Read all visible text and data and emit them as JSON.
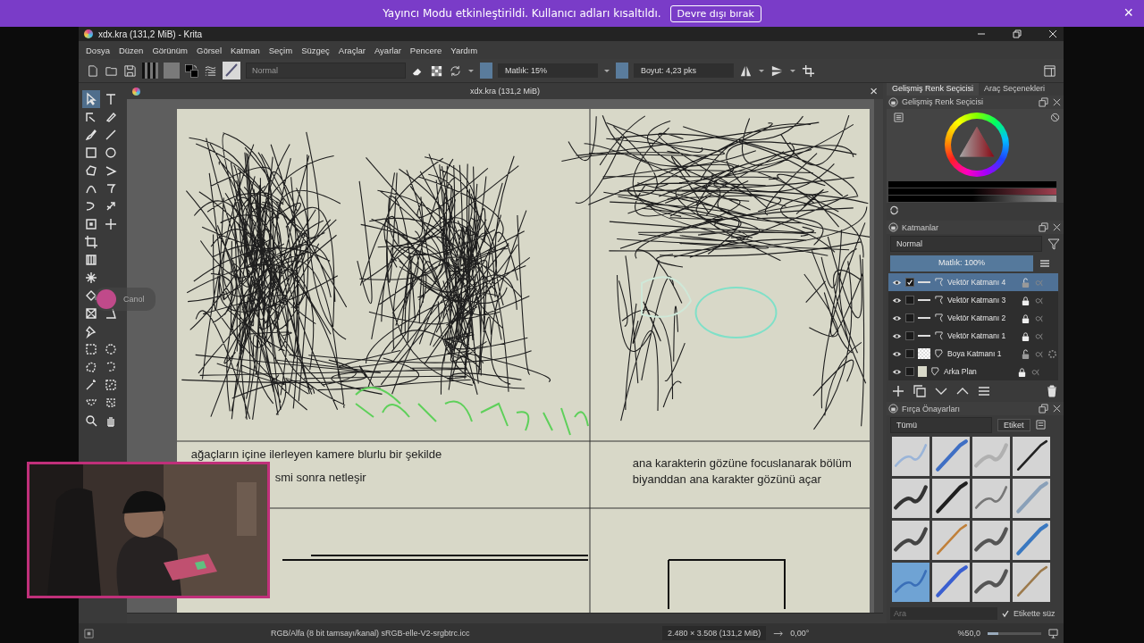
{
  "banner": {
    "message": "Yayıncı Modu etkinleştirildi. Kullanıcı adları kısaltıldı.",
    "button": "Devre dışı bırak",
    "close": "×"
  },
  "window": {
    "title": "xdx.kra (131,2 MiB)  - Krita"
  },
  "menu": [
    "Dosya",
    "Düzen",
    "Görünüm",
    "Görsel",
    "Katman",
    "Seçim",
    "Süzgeç",
    "Araçlar",
    "Ayarlar",
    "Pencere",
    "Yardım"
  ],
  "toolbar": {
    "blend_mode": "Normal",
    "opacity": "Matlık: 15%",
    "size": "Boyut: 4,23 pks"
  },
  "document_tab": {
    "title": "xdx.kra (131,2 MiB)",
    "close": "×"
  },
  "tools": [
    {
      "selected": true
    },
    {
      "selected": false
    },
    {
      "selected": false
    },
    {
      "selected": false
    },
    {
      "selected": false
    },
    {
      "selected": false
    },
    {
      "selected": false
    },
    {
      "selected": false
    },
    {
      "selected": false
    },
    {
      "selected": false
    },
    {
      "selected": false
    },
    {
      "selected": false
    },
    {
      "selected": false
    },
    {
      "selected": false
    },
    {
      "selected": false
    },
    {
      "selected": false
    },
    {
      "selected": false
    },
    {
      "selected": false
    },
    {
      "selected": false
    },
    {
      "selected": false
    },
    {
      "selected": false
    },
    {
      "selected": false
    },
    {
      "selected": false
    },
    {
      "selected": false
    },
    {
      "selected": false
    },
    {
      "selected": false
    },
    {
      "selected": false
    },
    {
      "selected": false
    },
    {
      "selected": false
    },
    {
      "selected": false
    },
    {
      "selected": false
    },
    {
      "selected": false
    },
    {
      "selected": false
    }
  ],
  "canvas": {
    "captions": [
      "ağaçların içine ilerleyen kamere blurlu bir şekilde",
      "smi sonra netleşir",
      "ana karakterin gözüne focuslanarak bölüm",
      "biyanddan ana karakter gözünü açar"
    ]
  },
  "stream_overlay": {
    "chat_name": "Canol"
  },
  "dock": {
    "tabs": [
      {
        "label": "Gelişmiş Renk Seçicisi",
        "selected": true
      },
      {
        "label": "Araç Seçenekleri",
        "selected": false
      }
    ],
    "color_selector": {
      "title": "Gelişmiş Renk Seçicisi"
    },
    "layers": {
      "title": "Katmanlar",
      "blend_mode": "Normal",
      "opacity": "Matlık: 100%",
      "level": 1,
      "items": [
        {
          "name": "Vektör Katmanı 4",
          "kind": "vector",
          "selected": true,
          "locked": false
        },
        {
          "name": "Vektör Katmanı 3",
          "kind": "vector",
          "selected": false,
          "locked": true
        },
        {
          "name": "Vektör Katmanı 2",
          "kind": "vector",
          "selected": false,
          "locked": true
        },
        {
          "name": "Vektör Katmanı 1",
          "kind": "vector",
          "selected": false,
          "locked": true
        },
        {
          "name": "Boya Katmanı 1",
          "kind": "paint",
          "selected": false,
          "locked": false
        },
        {
          "name": "Arka Plan",
          "kind": "background",
          "selected": false,
          "locked": true
        }
      ]
    },
    "brushes": {
      "title": "Fırça Önayarları",
      "filter": "Tümü",
      "tag_button": "Etiket",
      "search_placeholder": "Ara",
      "filter_in_tag": {
        "label": "Etikette süz",
        "checked": true
      },
      "presets": [
        {
          "selected": false
        },
        {
          "selected": false
        },
        {
          "selected": false
        },
        {
          "selected": false
        },
        {
          "selected": false
        },
        {
          "selected": false
        },
        {
          "selected": false
        },
        {
          "selected": false
        },
        {
          "selected": false
        },
        {
          "selected": false
        },
        {
          "selected": false
        },
        {
          "selected": false
        },
        {
          "selected": true
        },
        {
          "selected": false
        },
        {
          "selected": false
        },
        {
          "selected": false
        }
      ]
    }
  },
  "status_bar": {
    "color_profile": "RGB/Alfa (8 bit tamsayı/kanal) sRGB-elle-V2-srgbtrc.icc",
    "dimensions": "2.480 × 3.508 (131,2 MiB)",
    "rotation": "0,00°",
    "zoom": "%50,0",
    "level": 0.2
  }
}
